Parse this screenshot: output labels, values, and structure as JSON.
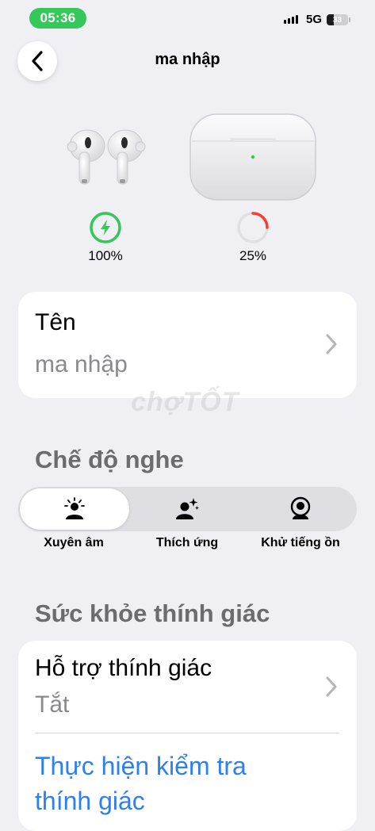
{
  "status_bar": {
    "time": "05:36",
    "network": "5G",
    "battery_level": "33",
    "colors": {
      "time_pill": "#34c759"
    }
  },
  "nav": {
    "back_icon": "chevron-left-icon",
    "title": "ma nhập"
  },
  "devices": {
    "earbuds": {
      "battery_text": "100%",
      "battery_fraction": 1.0,
      "charging": true,
      "ring_color": "#34c759"
    },
    "case": {
      "battery_text": "25%",
      "battery_fraction": 0.25,
      "charging": false,
      "ring_color": "#ff3b30"
    }
  },
  "name_card": {
    "label": "Tên",
    "value": "ma nhập",
    "chevron_icon": "chevron-right-icon"
  },
  "watermark": "chợTỐT",
  "listening_mode": {
    "header": "Chế độ nghe",
    "modes": [
      {
        "label": "Xuyên âm",
        "icon": "transparency-icon",
        "selected": true
      },
      {
        "label": "Thích ứng",
        "icon": "adaptive-icon",
        "selected": false
      },
      {
        "label": "Khử tiếng ồn",
        "icon": "noise-cancellation-icon",
        "selected": false
      }
    ]
  },
  "hearing_health": {
    "header": "Sức khỏe thính giác",
    "hearing_assist": {
      "label": "Hỗ trợ thính giác",
      "value": "Tắt"
    },
    "test_link": "Thực hiện kiểm tra thính giác",
    "colors": {
      "link": "#2f80ed"
    }
  }
}
